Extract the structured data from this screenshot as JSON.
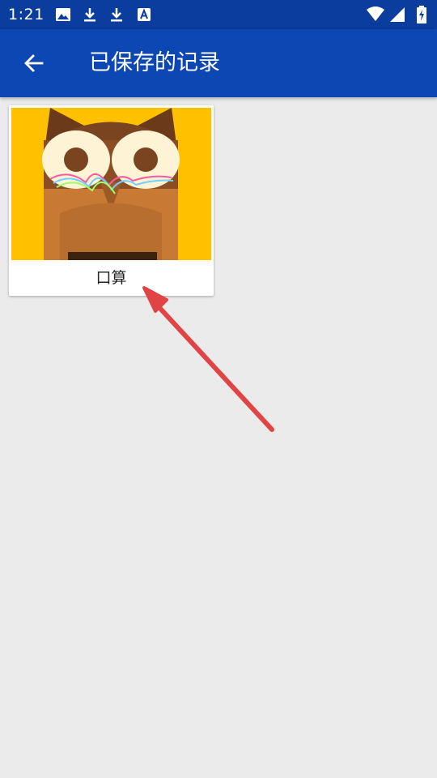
{
  "status_bar": {
    "time": "1:21",
    "left_icons": [
      "image-icon",
      "download-icon",
      "download-icon",
      "text-a-icon"
    ],
    "right_icons": [
      "wifi-icon",
      "signal-icon",
      "battery-charging-icon"
    ]
  },
  "app_bar": {
    "back_icon": "arrow-back-icon",
    "title": "已保存的记录"
  },
  "saved_records": [
    {
      "label": "口算",
      "thumbnail": "owl-mascot-image"
    }
  ],
  "colors": {
    "status_bar": "#0a3d9e",
    "app_bar": "#0d47b3",
    "background": "#ebebeb",
    "thumbnail_bg": "#ffc000",
    "annotation_arrow": "#e04444"
  }
}
